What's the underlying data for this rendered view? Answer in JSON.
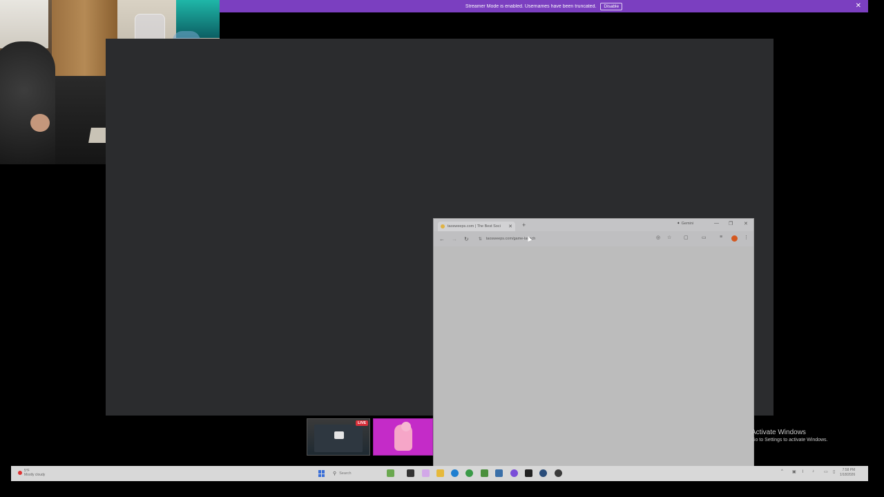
{
  "banner": {
    "text": "Streamer Mode is enabled. Usernames have been truncated.",
    "disable_label": "Disable",
    "close_glyph": "✕"
  },
  "browser": {
    "tab_title": "taosweeps.com | The Best Soci",
    "tab_close": "✕",
    "new_tab": "+",
    "gemini_star": "✦",
    "gemini_label": "Gemini",
    "minimize": "—",
    "maximize": "❐",
    "close": "✕",
    "back": "←",
    "forward": "→",
    "reload": "↻",
    "url": "taosweeps.com/game-launch",
    "site_icon": "⇅"
  },
  "stream": {
    "live_badge": "LIVE"
  },
  "activate_windows": {
    "title": "Activate Windows",
    "subtitle": "Go to Settings to activate Windows."
  },
  "taskbar": {
    "weather_temp": "5°F",
    "weather_desc": "Mostly cloudy",
    "search_placeholder": "Search",
    "clock_time": "7:58 PM",
    "clock_date": "1/18/2026"
  },
  "colors": {
    "banner": "#7b3fc0",
    "canvas": "#2b2c2e",
    "browser": "#bcbcbc",
    "live": "#d9303a",
    "thumb_pink": "#c42bc8"
  }
}
